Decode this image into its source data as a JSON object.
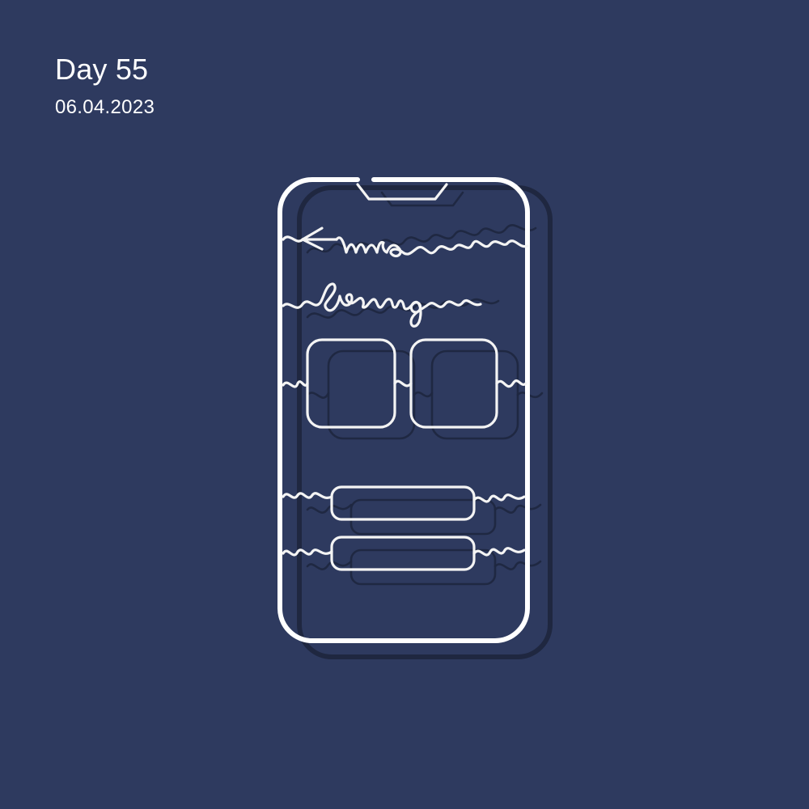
{
  "header": {
    "title": "Day 55",
    "date": "06.04.2023"
  },
  "illustration": {
    "subject": "wire phone sculpture",
    "handwritten_text": "wire framing",
    "icons": [
      "back-arrow-icon"
    ]
  },
  "colors": {
    "background": "#2e3a5f",
    "wire": "#f4f4f4",
    "shadow": "#1f2740",
    "text": "#ffffff"
  }
}
